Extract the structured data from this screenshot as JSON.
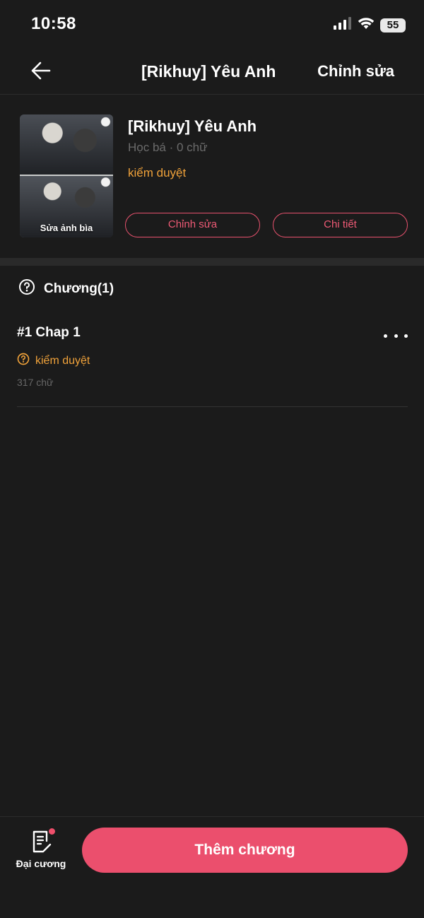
{
  "status_bar": {
    "time": "10:58",
    "battery": "55",
    "icons": [
      "signal-icon",
      "wifi-icon",
      "battery-icon"
    ]
  },
  "nav": {
    "title": "[Rikhuy] Yêu Anh",
    "edit_label": "Chỉnh sửa",
    "back_icon": "back-arrow-icon"
  },
  "story": {
    "title": "[Rikhuy] Yêu Anh",
    "meta": "Học bá · 0 chữ",
    "status": "kiểm duyệt",
    "cover_label": "Sửa ảnh bìa",
    "edit_button": "Chỉnh sửa",
    "detail_button": "Chi tiết"
  },
  "chapters": {
    "header": "Chương(1)",
    "items": [
      {
        "title": "#1 Chap 1",
        "status": "kiểm duyệt",
        "words": "317 chữ"
      }
    ]
  },
  "bottom": {
    "outline_label": "Đại cương",
    "add_chapter_label": "Thêm chương"
  },
  "colors": {
    "background": "#1b1b1b",
    "accent": "#eb4f6d",
    "status_orange": "#f0a23a",
    "muted_text": "#6b6b6b"
  }
}
